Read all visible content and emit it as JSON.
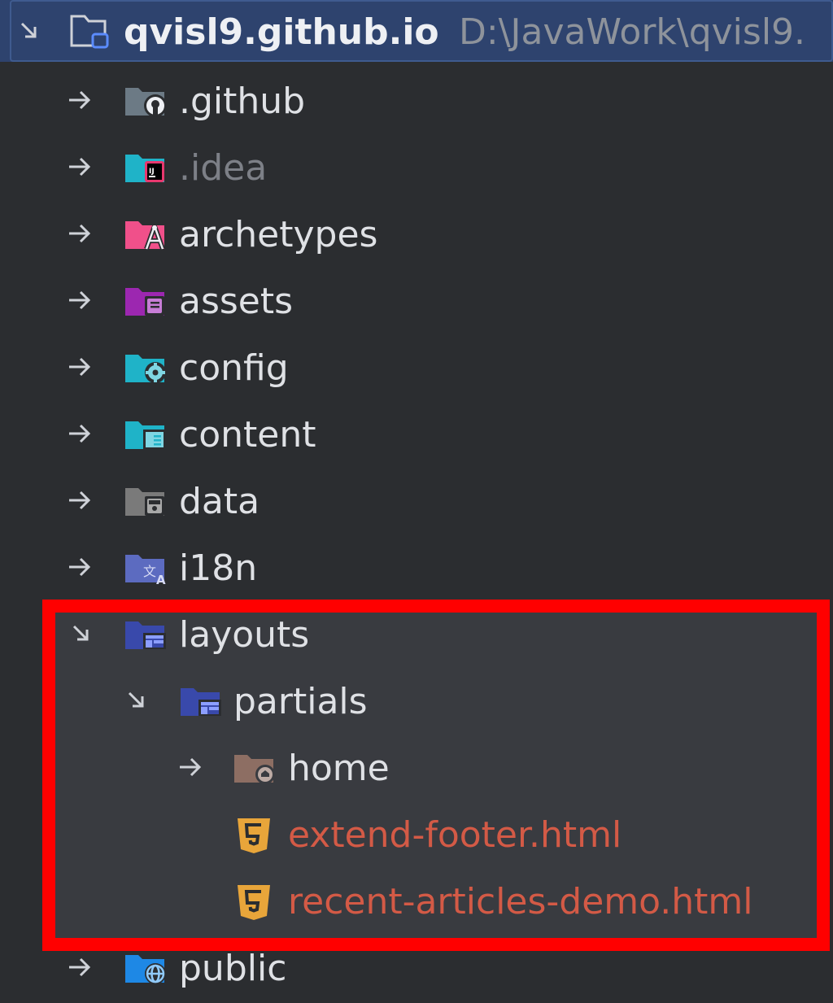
{
  "root": {
    "name": "qvisl9.github.io",
    "path": "D:\\JavaWork\\qvisl9."
  },
  "items": [
    {
      "label": ".github"
    },
    {
      "label": ".idea"
    },
    {
      "label": "archetypes"
    },
    {
      "label": "assets"
    },
    {
      "label": "config"
    },
    {
      "label": "content"
    },
    {
      "label": "data"
    },
    {
      "label": "i18n"
    },
    {
      "label": "layouts"
    },
    {
      "label": "partials"
    },
    {
      "label": "home"
    },
    {
      "label": "extend-footer.html"
    },
    {
      "label": "recent-articles-demo.html"
    },
    {
      "label": "public"
    }
  ],
  "colors": {
    "background": "#2b2d30",
    "selection": "#2e436e",
    "highlight_border": "#ff0000",
    "modified_file": "#d35a46",
    "excluded_folder": "#7d8087"
  }
}
